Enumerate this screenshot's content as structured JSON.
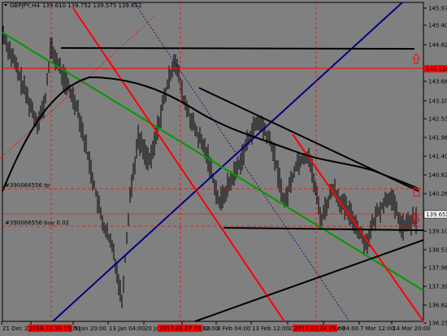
{
  "header": {
    "symbol_text": "GBPJPY,H4",
    "ohlc_text": "139.610 139.752 139.575 139.652"
  },
  "colors": {
    "background": "#808080",
    "candle": "#000000",
    "red_line": "#ff0000",
    "blue_line": "#000080",
    "green_line": "#009900",
    "black_line": "#000000",
    "price_tag_red": "#ff0000",
    "price_tag_gray": "#808080",
    "time_highlight": "#ff0000"
  },
  "price_axis": {
    "ticks": [
      "145.975",
      "145.405",
      "144.820",
      "143.680",
      "143.105",
      "142.535",
      "141.960",
      "141.400",
      "140.820",
      "140.260",
      "139.105",
      "138.535",
      "137.965",
      "137.395",
      "136.825",
      "136.250"
    ],
    "tag_red": "144.110",
    "tag_current": "139.652"
  },
  "time_axis": {
    "labels": [
      "21 Dec 2016",
      "3 Jan 2017",
      "5 Jan 20:00",
      "13 Jan 04:00",
      "20 Jan 2017",
      "31 Jan 12:00",
      "8 Feb 04:00",
      "13 Feb 12:00",
      "20 Feb 2017",
      "2 Mar 04:00",
      "7 Mar 12:00",
      "14 Mar 20:00"
    ],
    "highlighted": [
      "2016.12.30 19:00",
      "2017.01.27 23:00",
      "2017.02.24 20:00"
    ]
  },
  "order_labels": {
    "tp_label": "#390066556 tp",
    "buy_label": "#390066556 buy 0.02"
  },
  "chart_data": {
    "type": "candlestick",
    "title": "GBPJPY,H4",
    "ylim": [
      136.0,
      146.2
    ],
    "trend_levels": {
      "horizontal_black_top": 144.68,
      "horizontal_black_mid": 139.25,
      "red_level": 144.11,
      "tp_level": 140.4,
      "buy_level": 139.05,
      "current_price": 139.652
    }
  }
}
